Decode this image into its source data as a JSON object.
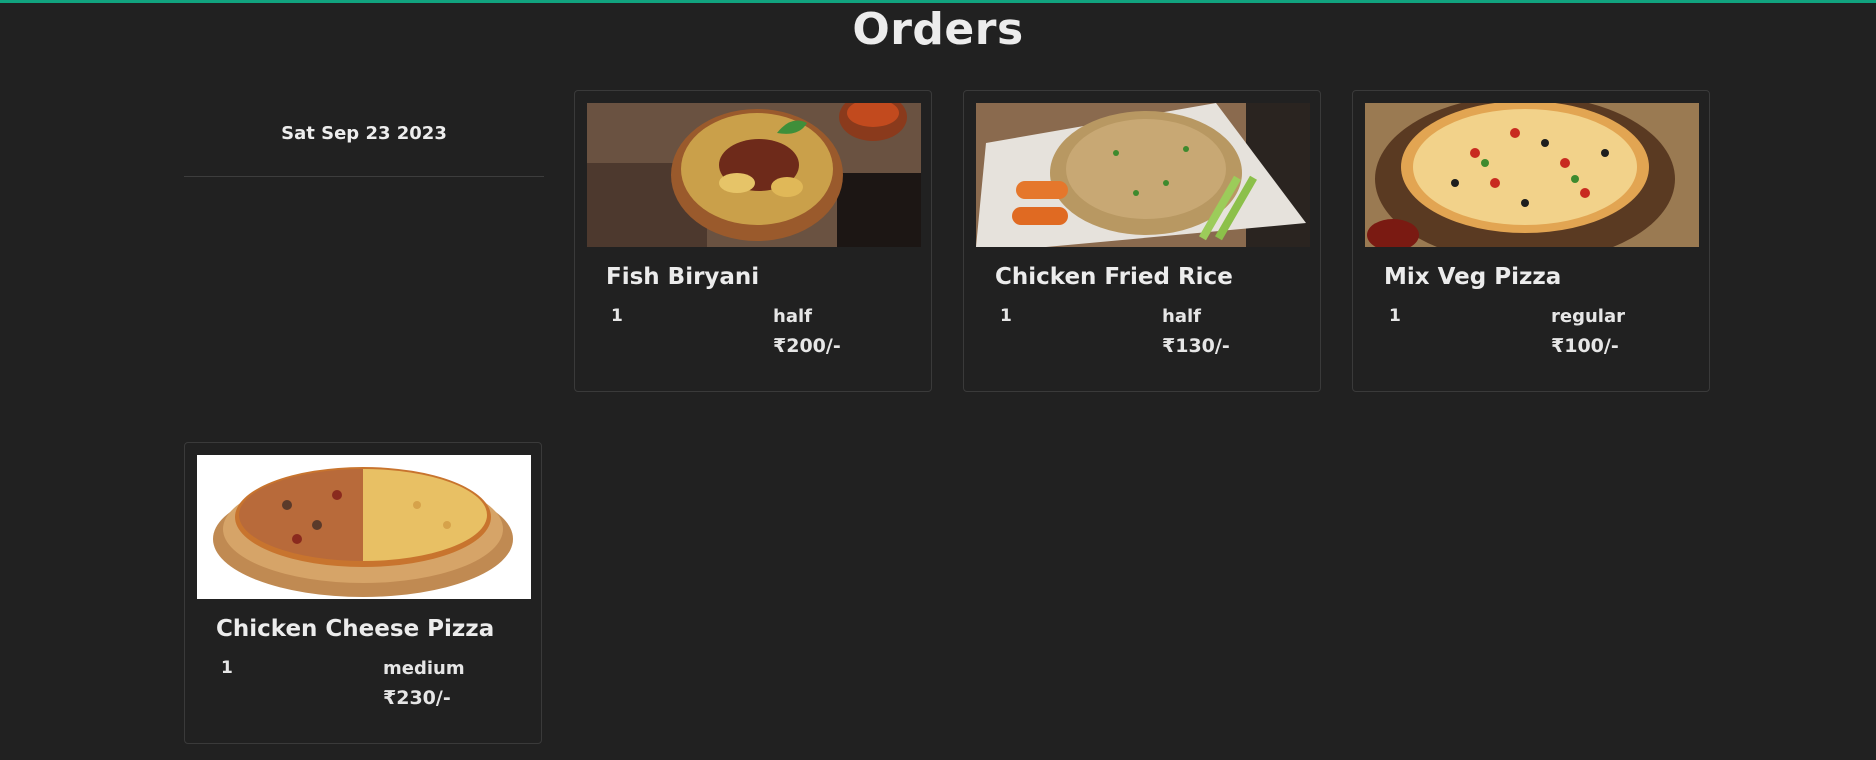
{
  "header": {
    "title": "Orders",
    "accent_color": "#11a37f"
  },
  "date_group": {
    "date": "Sat Sep 23 2023"
  },
  "orders": [
    {
      "name": "Fish Biryani",
      "quantity": "1",
      "size": "half",
      "price": "₹200/-",
      "image": "fish-biryani-image"
    },
    {
      "name": "Chicken Fried Rice",
      "quantity": "1",
      "size": "half",
      "price": "₹130/-",
      "image": "chicken-fried-rice-image"
    },
    {
      "name": "Mix Veg Pizza",
      "quantity": "1",
      "size": "regular",
      "price": "₹100/-",
      "image": "mix-veg-pizza-image"
    },
    {
      "name": "Chicken Cheese Pizza",
      "quantity": "1",
      "size": "medium",
      "price": "₹230/-",
      "image": "chicken-cheese-pizza-image"
    }
  ]
}
